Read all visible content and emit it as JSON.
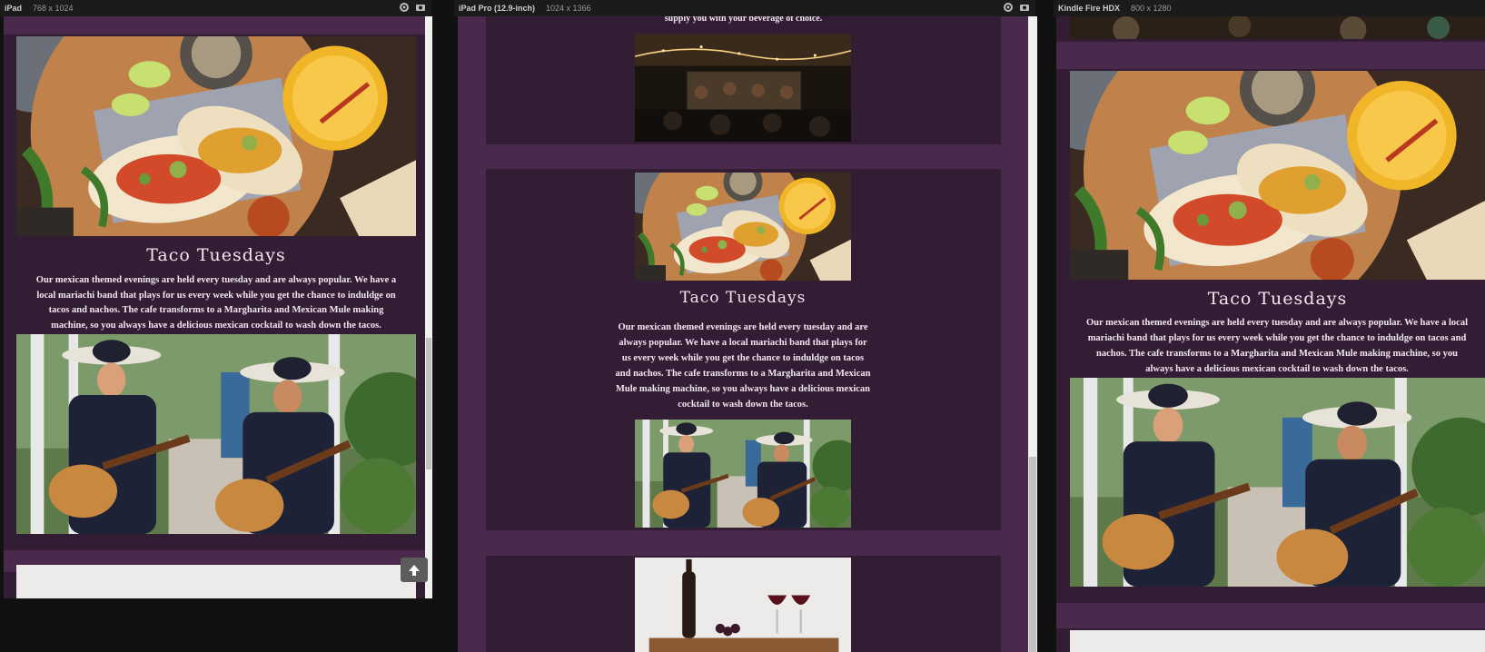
{
  "devices": [
    {
      "name": "iPad",
      "size": "768 x 1024"
    },
    {
      "name": "iPad Pro (12.9-inch)",
      "size": "1024 x 1366"
    },
    {
      "name": "Kindle Fire HDX",
      "size": "800 x 1280"
    }
  ],
  "icons": {
    "settings": "gear-icon",
    "screenshot": "camera-icon",
    "scroll_top": "arrow-up-icon"
  },
  "content": {
    "prev_text_fragment": "supply you with your beverage of choice.",
    "taco_title": "Taco Tuesdays",
    "taco_body": "Our mexican themed evenings are held every tuesday and are always popular. We have a local mariachi band that plays for us every week while you get the chance to induldge on tacos and nachos. The cafe transforms to a Margharita and Mexican Mule making machine, so you always have a delicious mexican cocktail to wash down the tacos."
  },
  "colors": {
    "page_band": "#4a2a4c",
    "panel": "#321d34",
    "text": "#f1e6f1",
    "toolbar": "#1b1b1b"
  }
}
